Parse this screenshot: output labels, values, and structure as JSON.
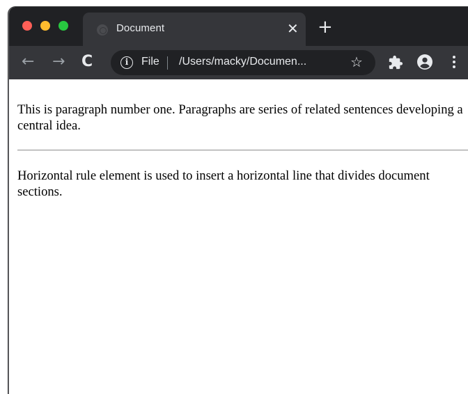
{
  "window": {
    "controls": [
      "close",
      "minimize",
      "maximize"
    ]
  },
  "tab": {
    "title": "Document",
    "close_glyph": "✕",
    "new_tab_glyph": "+"
  },
  "toolbar": {
    "back_glyph": "←",
    "forward_glyph": "→",
    "reload_glyph": "C",
    "info_glyph": "i",
    "scheme_label": "File",
    "url": "/Users/macky/Documen...",
    "star_glyph": "☆",
    "icons": [
      "back-icon",
      "forward-icon",
      "reload-icon",
      "info-icon",
      "bookmark-star-icon",
      "extensions-puzzle-icon",
      "profile-icon",
      "more-menu-icon"
    ]
  },
  "page": {
    "paragraph_1": "This is paragraph number one. Paragraphs are series of related sentences developing a central idea.",
    "paragraph_2": "Horizontal rule element is used to insert a horizontal line that divides document sections."
  },
  "colors": {
    "tabstrip_bg": "#202124",
    "toolbar_bg": "#35363a",
    "close_red": "#ff5f57",
    "minimize_yellow": "#febc2e",
    "maximize_green": "#28c840"
  }
}
